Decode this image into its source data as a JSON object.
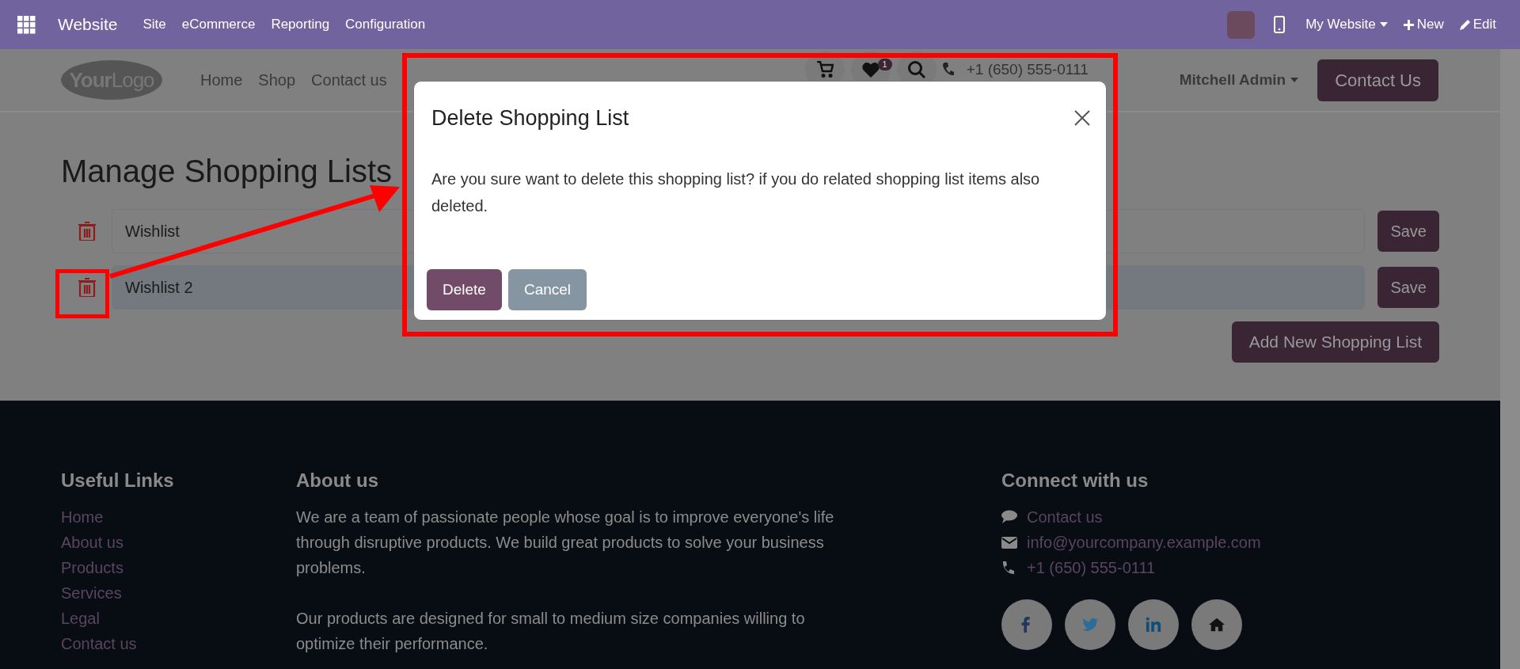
{
  "topbar": {
    "app": "Website",
    "menu": [
      "Site",
      "eCommerce",
      "Reporting",
      "Configuration"
    ],
    "switcher": "My Website",
    "actions": [
      {
        "label": "New",
        "kind": "new"
      },
      {
        "label": "Edit",
        "kind": "edit"
      }
    ]
  },
  "header": {
    "logo": "**Your**Logo",
    "nav": [
      "Home",
      "Shop",
      "Contact us"
    ],
    "wishlist_count": "1",
    "phone": "+1 (650) 555-0111",
    "user": "Mitchell Admin",
    "cta": "Contact Us"
  },
  "page": {
    "title": "Manage Shopping Lists",
    "lists": [
      {
        "name": "Wishlist",
        "selected": false,
        "save": "Save"
      },
      {
        "name": "Wishlist 2",
        "selected": true,
        "save": "Save"
      }
    ],
    "add": "Add New Shopping List"
  },
  "dialog": {
    "title": "Delete Shopping List",
    "message": "Are you sure want to delete this shopping list? if you do related shopping list items also deleted.",
    "buttons": [
      {
        "label": "Delete",
        "kind": "primary"
      },
      {
        "label": "Cancel",
        "kind": "secondary"
      }
    ]
  },
  "footer": {
    "links_title": "Useful Links",
    "links": [
      "Home",
      "About us",
      "Products",
      "Services",
      "Legal",
      "Contact us"
    ],
    "about_title": "About us",
    "about": [
      "We are a team of passionate people whose goal is to improve everyone's life through disruptive products. We build great products to solve your business problems.",
      "Our products are designed for small to medium size companies willing to optimize their performance."
    ],
    "connect_title": "Connect with us",
    "contacts": [
      {
        "text": "Contact us",
        "kind": "chat"
      },
      {
        "text": "info@yourcompany.example.com",
        "kind": "mail"
      },
      {
        "text": "+1 (650) 555-0111",
        "kind": "phone"
      }
    ],
    "social": [
      {
        "kind": "facebook"
      },
      {
        "kind": "twitter"
      },
      {
        "kind": "linkedin"
      },
      {
        "kind": "home"
      }
    ]
  }
}
